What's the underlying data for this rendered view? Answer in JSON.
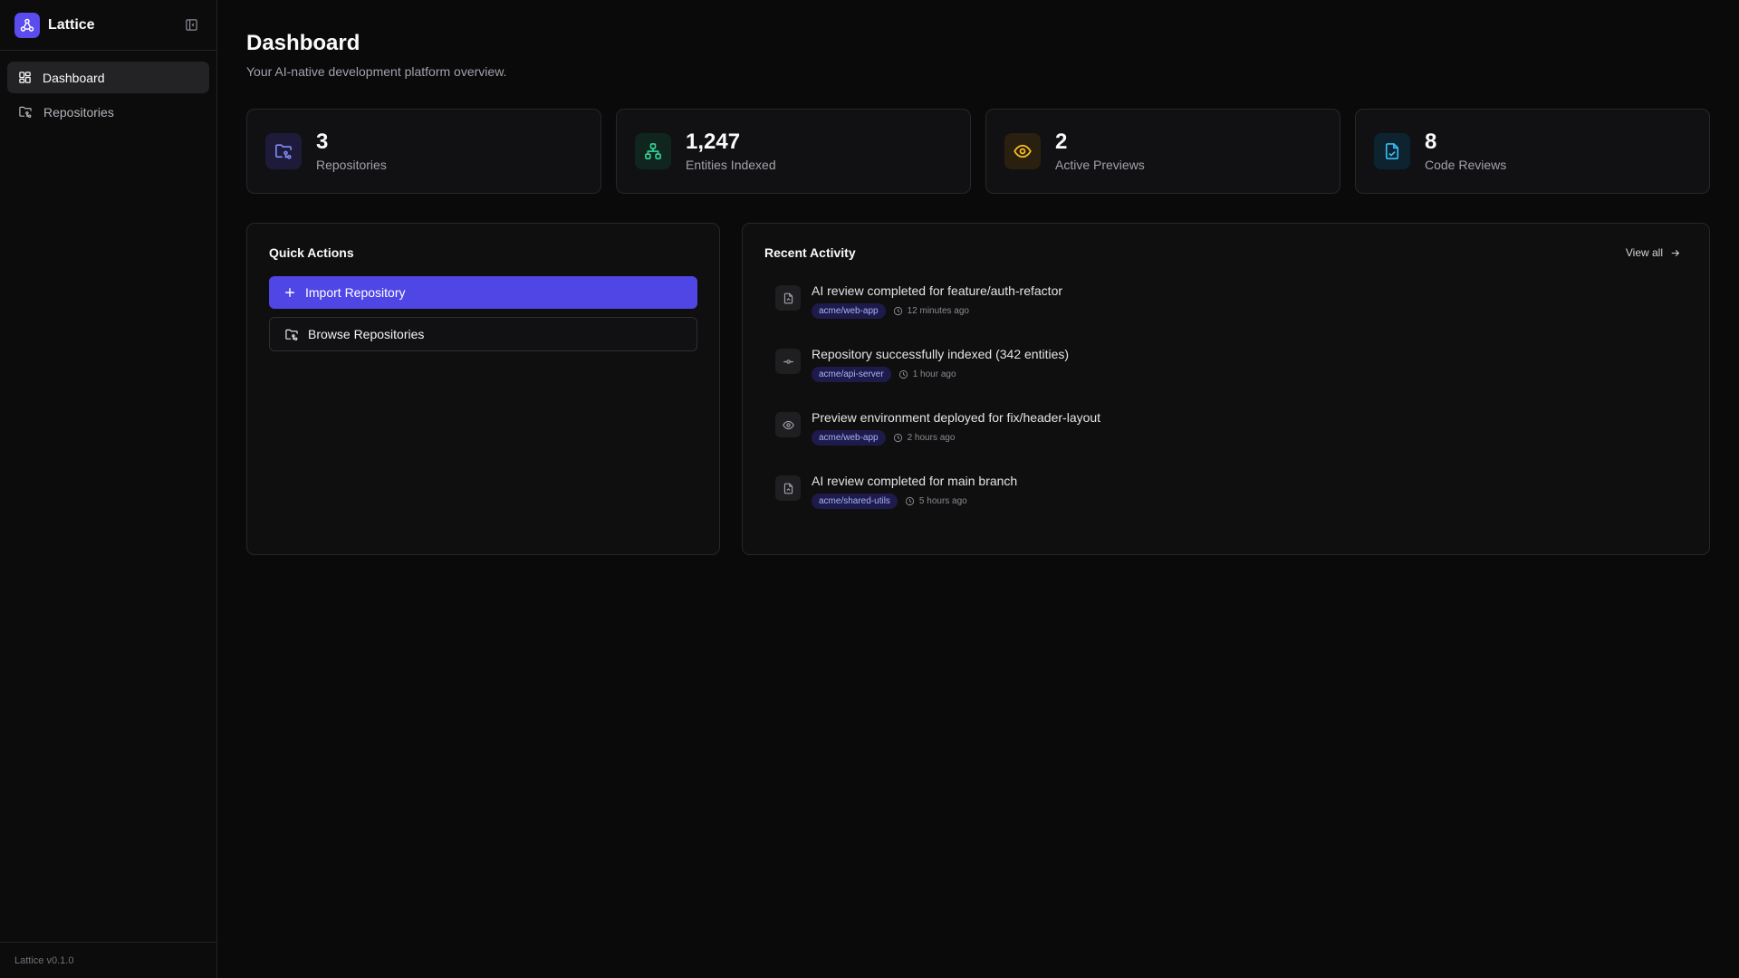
{
  "app": {
    "name": "Lattice",
    "version": "Lattice v0.1.0"
  },
  "sidebar": {
    "items": [
      {
        "label": "Dashboard",
        "icon": "dashboard-grid-icon",
        "active": true
      },
      {
        "label": "Repositories",
        "icon": "folder-git-icon",
        "active": false
      }
    ]
  },
  "page": {
    "title": "Dashboard",
    "subtitle": "Your AI-native development platform overview."
  },
  "stats": [
    {
      "value": "3",
      "label": "Repositories",
      "icon": "folder-git-icon",
      "color": "#818cf8"
    },
    {
      "value": "1,247",
      "label": "Entities Indexed",
      "icon": "network-icon",
      "color": "#34d399"
    },
    {
      "value": "2",
      "label": "Active Previews",
      "icon": "eye-icon",
      "color": "#fbbf24"
    },
    {
      "value": "8",
      "label": "Code Reviews",
      "icon": "file-check-icon",
      "color": "#38bdf8"
    }
  ],
  "quick_actions": {
    "title": "Quick Actions",
    "import_label": "Import Repository",
    "browse_label": "Browse Repositories"
  },
  "recent_activity": {
    "title": "Recent Activity",
    "view_all": "View all",
    "items": [
      {
        "text": "AI review completed for feature/auth-refactor",
        "repo": "acme/web-app",
        "time": "12 minutes ago",
        "icon": "file-review-icon"
      },
      {
        "text": "Repository successfully indexed (342 entities)",
        "repo": "acme/api-server",
        "time": "1 hour ago",
        "icon": "commit-icon"
      },
      {
        "text": "Preview environment deployed for fix/header-layout",
        "repo": "acme/web-app",
        "time": "2 hours ago",
        "icon": "eye-icon"
      },
      {
        "text": "AI review completed for main branch",
        "repo": "acme/shared-utils",
        "time": "5 hours ago",
        "icon": "file-review-icon"
      }
    ]
  },
  "colors": {
    "accent": "#4f46e5",
    "logo": "#5b4cf0"
  }
}
